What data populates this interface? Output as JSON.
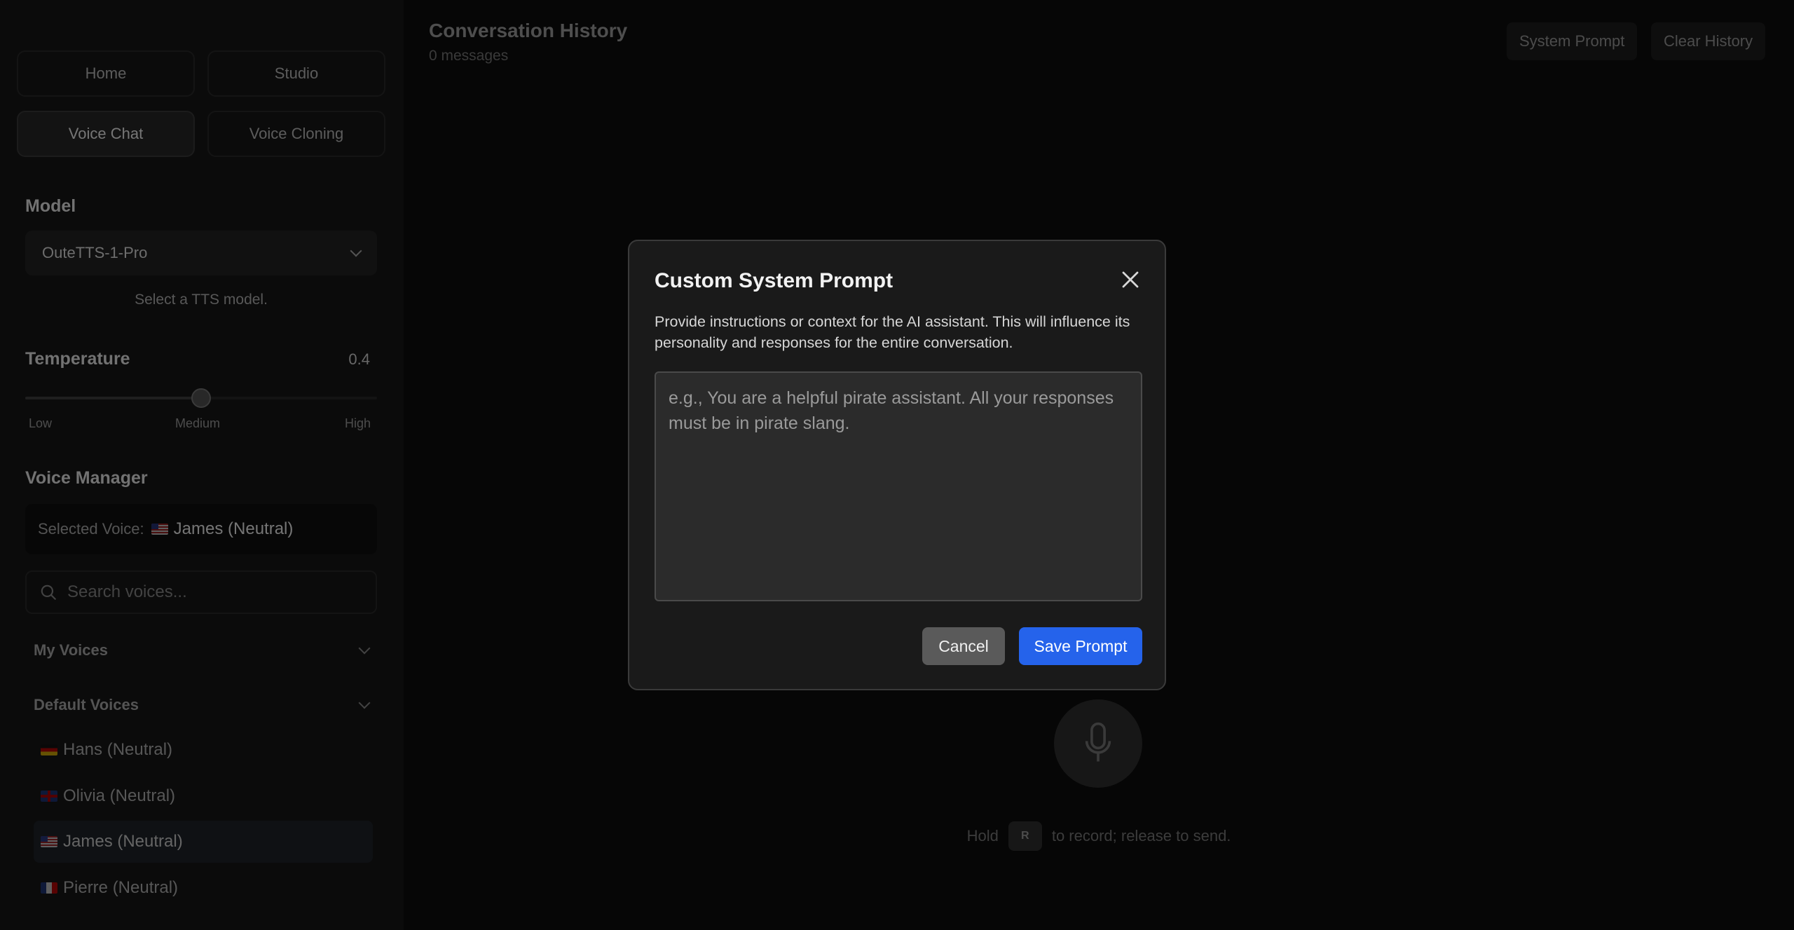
{
  "nav": {
    "home": "Home",
    "studio": "Studio",
    "voice_chat": "Voice Chat",
    "voice_cloning": "Voice Cloning",
    "active": "Voice Chat"
  },
  "model": {
    "title": "Model",
    "selected": "OuteTTS-1-Pro",
    "helper": "Select a TTS model."
  },
  "temperature": {
    "title": "Temperature",
    "value": "0.4",
    "level": 0.5,
    "low": "Low",
    "medium": "Medium",
    "high": "High"
  },
  "voice_manager": {
    "title": "Voice Manager",
    "selected_label": "Selected Voice:",
    "selected_voice": "James (Neutral)",
    "search_placeholder": "Search voices...",
    "my_voices": "My Voices",
    "default_voices": "Default Voices",
    "voices": [
      {
        "name": "Hans (Neutral)",
        "flag": "de"
      },
      {
        "name": "Olivia (Neutral)",
        "flag": "gb"
      },
      {
        "name": "James (Neutral)",
        "flag": "us",
        "selected": true
      },
      {
        "name": "Pierre (Neutral)",
        "flag": "fr"
      }
    ]
  },
  "main": {
    "title": "Conversation History",
    "subtitle": "0 messages",
    "system_prompt_button": "System Prompt",
    "clear_history_button": "Clear History",
    "hint_before": "Hold",
    "hint_key": "R",
    "hint_after": "to record; release to send."
  },
  "modal": {
    "title": "Custom System Prompt",
    "description": "Provide instructions or context for the AI assistant. This will influence its personality and responses for the entire conversation.",
    "placeholder": "e.g., You are a helpful pirate assistant. All your responses must be in pirate slang.",
    "value": "",
    "cancel": "Cancel",
    "save": "Save Prompt"
  },
  "colors": {
    "accent": "#2563eb",
    "cancel": "#5a5a5a",
    "sidebar_bg": "#141414",
    "main_bg": "#0b0b0b"
  },
  "icons": {
    "search": "search-icon",
    "close": "close-icon",
    "mic": "microphone-icon",
    "chevron": "chevron-down-icon"
  }
}
